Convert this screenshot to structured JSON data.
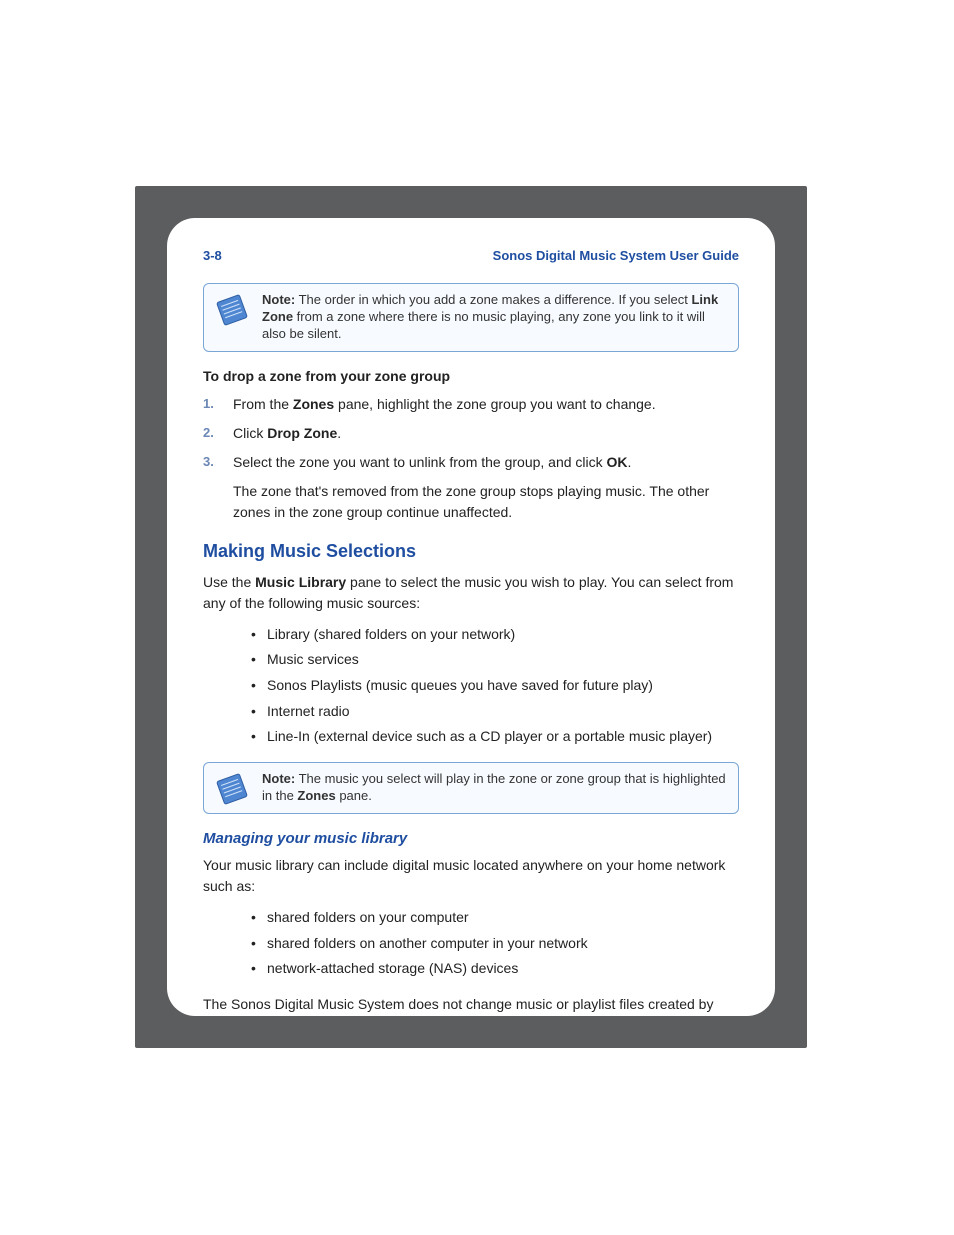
{
  "header": {
    "page_number": "3-8",
    "doc_title": "Sonos Digital Music System User Guide"
  },
  "note1": {
    "label": "Note:",
    "segments": [
      {
        "t": "  The order in which you add a zone makes a difference. If you select ",
        "b": false
      },
      {
        "t": "Link Zone",
        "b": true
      },
      {
        "t": " from a zone where there is no music playing, any zone you link to it will also be silent.",
        "b": false
      }
    ]
  },
  "drop_zone": {
    "heading": "To drop a zone from your zone group",
    "steps": [
      [
        {
          "t": "From the ",
          "b": false
        },
        {
          "t": "Zones",
          "b": true
        },
        {
          "t": " pane, highlight the zone group you want to change.",
          "b": false
        }
      ],
      [
        {
          "t": "Click ",
          "b": false
        },
        {
          "t": "Drop Zone",
          "b": true
        },
        {
          "t": ".",
          "b": false
        }
      ],
      [
        {
          "t": "Select the zone you want to unlink from the group, and click ",
          "b": false
        },
        {
          "t": "OK",
          "b": true
        },
        {
          "t": ".",
          "b": false
        }
      ]
    ],
    "after": "The zone that's removed from the zone group stops playing music. The other zones in the zone group continue unaffected."
  },
  "selections": {
    "heading": "Making Music Selections",
    "intro_segments": [
      {
        "t": "Use the ",
        "b": false
      },
      {
        "t": "Music Library",
        "b": true
      },
      {
        "t": " pane to select the music you wish to play. You can select from any of the following music sources:",
        "b": false
      }
    ],
    "sources": [
      "Library (shared folders on your network)",
      "Music services",
      "Sonos Playlists (music queues you have saved for future play)",
      "Internet radio",
      "Line-In (external device such as a CD player or a portable music player)"
    ]
  },
  "note2": {
    "label": "Note:",
    "segments": [
      {
        "t": "  The music you select will play in the zone or zone group that is highlighted in the ",
        "b": false
      },
      {
        "t": "Zones",
        "b": true
      },
      {
        "t": " pane.",
        "b": false
      }
    ]
  },
  "library": {
    "heading": "Managing your music library",
    "intro": "Your music library can include digital music located anywhere on your home network such as:",
    "items": [
      "shared folders on your computer",
      "shared folders on another computer in your network",
      "network-attached storage (NAS) devices"
    ],
    "footer": "The Sonos Digital Music System does not change music or playlist files created by other applications; these files are always treated as \"read-only\"."
  }
}
